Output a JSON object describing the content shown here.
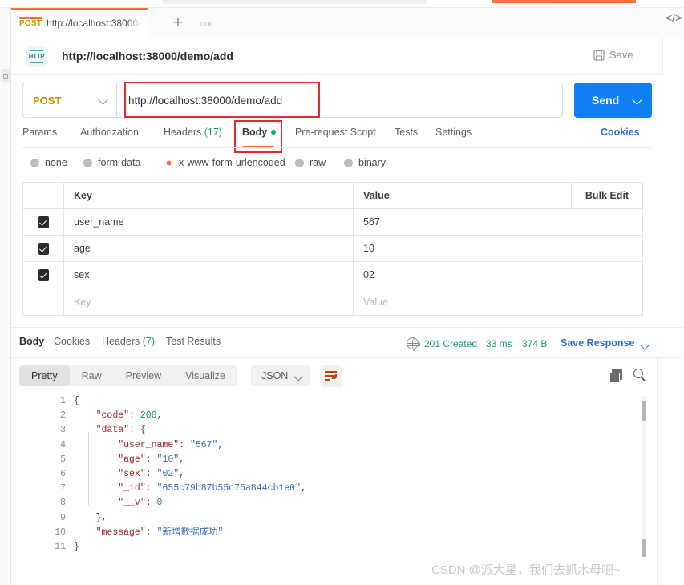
{
  "tab": {
    "method": "POST",
    "title": "http://localhost:38000/d",
    "plus": "+",
    "more": "◦◦◦"
  },
  "breadcrumb": {
    "icon_label": "HTTP",
    "title": "http://localhost:38000/demo/add",
    "save_label": "Save",
    "code_label": "</>"
  },
  "request": {
    "method": "POST",
    "url": "http://localhost:38000/demo/add",
    "send_label": "Send",
    "tabs": [
      {
        "label": "Params",
        "count": "",
        "active": false
      },
      {
        "label": "Authorization",
        "count": "",
        "active": false
      },
      {
        "label": "Headers",
        "count": "(17)",
        "active": false
      },
      {
        "label": "Body",
        "count": "",
        "active": true
      },
      {
        "label": "Pre-request Script",
        "count": "",
        "active": false
      },
      {
        "label": "Tests",
        "count": "",
        "active": false
      },
      {
        "label": "Settings",
        "count": "",
        "active": false
      }
    ],
    "cookies_link": "Cookies",
    "body_types": [
      {
        "label": "none",
        "selected": false
      },
      {
        "label": "form-data",
        "selected": false
      },
      {
        "label": "x-www-form-urlencoded",
        "selected": true
      },
      {
        "label": "raw",
        "selected": false
      },
      {
        "label": "binary",
        "selected": false
      }
    ]
  },
  "kvtable": {
    "headers": {
      "key": "Key",
      "value": "Value",
      "bulk": "Bulk Edit"
    },
    "rows": [
      {
        "checked": true,
        "key": "user_name",
        "value": "567"
      },
      {
        "checked": true,
        "key": "age",
        "value": "10"
      },
      {
        "checked": true,
        "key": "sex",
        "value": "02"
      }
    ],
    "placeholder_row": {
      "key": "Key",
      "value": "Value"
    }
  },
  "response": {
    "tabs": [
      {
        "label": "Body",
        "count": "",
        "active": true
      },
      {
        "label": "Cookies",
        "count": "",
        "active": false
      },
      {
        "label": "Headers",
        "count": "(7)",
        "active": false
      },
      {
        "label": "Test Results",
        "count": "",
        "active": false
      }
    ],
    "status": "201 Created",
    "time": "33 ms",
    "size": "374 B",
    "save_response": "Save Response",
    "views": [
      {
        "label": "Pretty",
        "active": true
      },
      {
        "label": "Raw",
        "active": false
      },
      {
        "label": "Preview",
        "active": false
      },
      {
        "label": "Visualize",
        "active": false
      }
    ],
    "format": "JSON",
    "body_lines": [
      {
        "n": "1",
        "segments": [
          {
            "t": "{",
            "c": "b"
          }
        ]
      },
      {
        "n": "2",
        "segments": [
          {
            "t": "    ",
            "c": "p"
          },
          {
            "t": "\"code\"",
            "c": "k"
          },
          {
            "t": ": ",
            "c": "p"
          },
          {
            "t": "200",
            "c": "n"
          },
          {
            "t": ",",
            "c": "p"
          }
        ]
      },
      {
        "n": "3",
        "segments": [
          {
            "t": "    ",
            "c": "p"
          },
          {
            "t": "\"data\"",
            "c": "k"
          },
          {
            "t": ": {",
            "c": "p"
          }
        ]
      },
      {
        "n": "4",
        "segments": [
          {
            "t": "        ",
            "c": "p"
          },
          {
            "t": "\"user_name\"",
            "c": "k"
          },
          {
            "t": ": ",
            "c": "p"
          },
          {
            "t": "\"567\"",
            "c": "s"
          },
          {
            "t": ",",
            "c": "p"
          }
        ]
      },
      {
        "n": "5",
        "segments": [
          {
            "t": "        ",
            "c": "p"
          },
          {
            "t": "\"age\"",
            "c": "k"
          },
          {
            "t": ": ",
            "c": "p"
          },
          {
            "t": "\"10\"",
            "c": "s"
          },
          {
            "t": ",",
            "c": "p"
          }
        ]
      },
      {
        "n": "6",
        "segments": [
          {
            "t": "        ",
            "c": "p"
          },
          {
            "t": "\"sex\"",
            "c": "k"
          },
          {
            "t": ": ",
            "c": "p"
          },
          {
            "t": "\"02\"",
            "c": "s"
          },
          {
            "t": ",",
            "c": "p"
          }
        ]
      },
      {
        "n": "7",
        "segments": [
          {
            "t": "        ",
            "c": "p"
          },
          {
            "t": "\"_id\"",
            "c": "k"
          },
          {
            "t": ": ",
            "c": "p"
          },
          {
            "t": "\"655c79b87b55c75a844cb1e0\"",
            "c": "s"
          },
          {
            "t": ",",
            "c": "p"
          }
        ]
      },
      {
        "n": "8",
        "segments": [
          {
            "t": "        ",
            "c": "p"
          },
          {
            "t": "\"__v\"",
            "c": "k"
          },
          {
            "t": ": ",
            "c": "p"
          },
          {
            "t": "0",
            "c": "n"
          }
        ]
      },
      {
        "n": "9",
        "segments": [
          {
            "t": "    },",
            "c": "p"
          }
        ]
      },
      {
        "n": "10",
        "segments": [
          {
            "t": "    ",
            "c": "p"
          },
          {
            "t": "\"message\"",
            "c": "k"
          },
          {
            "t": ": ",
            "c": "p"
          },
          {
            "t": "\"新增数据成功\"",
            "c": "s"
          }
        ]
      },
      {
        "n": "11",
        "segments": [
          {
            "t": "}",
            "c": "b"
          }
        ]
      }
    ]
  },
  "watermark": "CSDN @派大星，我们去抓水母吧~",
  "colors": {
    "accent": "#ff6c37",
    "send": "#0f7ff1",
    "link": "#2f6fe0",
    "success": "#1aa06d",
    "method": "#c99100",
    "annotation": "#e8262d"
  }
}
